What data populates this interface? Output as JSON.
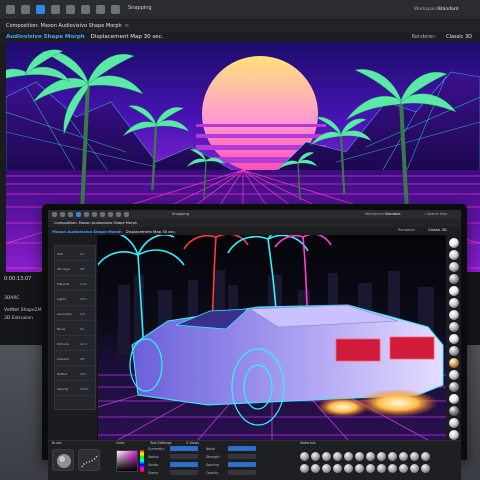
{
  "back_window": {
    "snapping_label": "Snapping",
    "workspace_label": "Workspace:",
    "workspace_value": "Standard",
    "tabs": [
      {
        "label": "Composition: Maxon Audiovisivo Shape Morph"
      }
    ],
    "breadcrumbs": [
      {
        "label": "Audiovisivo Shape Morph",
        "active": true
      },
      {
        "label": "Displacement Map 30 sec.",
        "active": false
      }
    ],
    "renderer_label": "Renderer:",
    "renderer_value": "Classic 3D",
    "timecode": "0:00:13:07",
    "layers": [
      "3DARC",
      "VetNet Shape2Mes",
      "3D Extrusion"
    ]
  },
  "front_window": {
    "snapping_label": "Snapping",
    "workspace_label": "Workspace:",
    "workspace_value": "Standard",
    "search_label": "Search Help",
    "tabs": [
      {
        "label": "Composition: Maxon Audiovisivo Shape Morph"
      }
    ],
    "breadcrumbs": [
      {
        "label": "Maxon Audiovisivo Shape Morph",
        "active": true
      },
      {
        "label": "Displacement Map 30 sec.",
        "active": false
      }
    ],
    "renderer_label": "Renderer:",
    "renderer_value": "Classic 3D",
    "properties": [
      "Edit",
      "3D Layer",
      "Material",
      "Lights",
      "Geometry",
      "Bevel",
      "Extrude",
      "Shadow",
      "Reflect",
      "Opacity"
    ],
    "property_values": [
      "On",
      "Off",
      "Auto",
      "50%",
      "2.0",
      "On",
      "12.0",
      "Off",
      "30%",
      "100%"
    ],
    "bottom_tabs": [
      "Brush",
      "Color",
      "Tool Settings",
      "Materials"
    ],
    "controls": [
      {
        "label": "Symmetry"
      },
      {
        "label": "Radius"
      },
      {
        "label": "Stroke"
      },
      {
        "label": "Stamp"
      },
      {
        "label": "Noise"
      },
      {
        "label": "Strength"
      },
      {
        "label": "Spacing"
      },
      {
        "label": "Opacity"
      }
    ],
    "zoom": "0 Views"
  },
  "colors": {
    "accent_blue": "#4aa3ff",
    "neon_pink": "#ff3fd0",
    "neon_cyan": "#2ff3ff",
    "sun_top": "#ffd86a",
    "sun_bottom": "#ff4fb4"
  },
  "icons": [
    "toolbar-icon",
    "search-icon",
    "material-ball-icon",
    "brush-icon"
  ]
}
